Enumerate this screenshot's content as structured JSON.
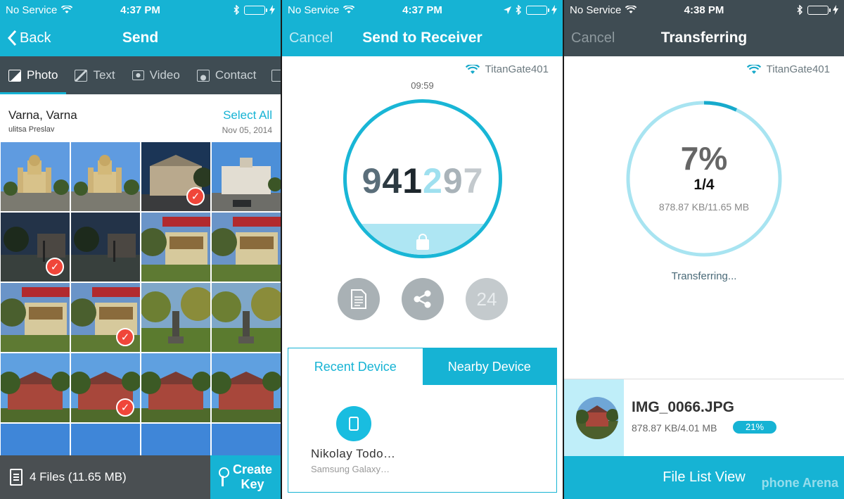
{
  "colors": {
    "accent": "#16b3d4",
    "dark_tab": "#3f4c53",
    "check": "#f0463a"
  },
  "screen1": {
    "status": {
      "carrier": "No Service",
      "time": "4:37 PM"
    },
    "nav": {
      "back_label": "Back",
      "title": "Send"
    },
    "tabs": [
      {
        "label": "Photo",
        "icon": "photo-icon"
      },
      {
        "label": "Text",
        "icon": "edit-icon"
      },
      {
        "label": "Video",
        "icon": "video-icon"
      },
      {
        "label": "Contact",
        "icon": "contact-icon"
      }
    ],
    "location": {
      "city": "Varna, Varna",
      "street": "ulitsa Preslav",
      "select_all": "Select All",
      "date": "Nov 05, 2014"
    },
    "photos": [
      {
        "scene": "cathedral",
        "selected": false
      },
      {
        "scene": "cathedral",
        "selected": false
      },
      {
        "scene": "building-dusk",
        "selected": true
      },
      {
        "scene": "building-day",
        "selected": false
      },
      {
        "scene": "dark-street",
        "selected": true
      },
      {
        "scene": "dark-street",
        "selected": false
      },
      {
        "scene": "garden-wall",
        "selected": false
      },
      {
        "scene": "garden-wall",
        "selected": false
      },
      {
        "scene": "garden-wall",
        "selected": false
      },
      {
        "scene": "garden-wall",
        "selected": true
      },
      {
        "scene": "park-statue",
        "selected": false
      },
      {
        "scene": "park-statue",
        "selected": false
      },
      {
        "scene": "red-building",
        "selected": false
      },
      {
        "scene": "red-building",
        "selected": true
      },
      {
        "scene": "red-building",
        "selected": false
      },
      {
        "scene": "red-building",
        "selected": false
      },
      {
        "scene": "trees-sky",
        "selected": false
      },
      {
        "scene": "trees-sky",
        "selected": false
      },
      {
        "scene": "trees-sky",
        "selected": false
      },
      {
        "scene": "trees-sky",
        "selected": false
      }
    ],
    "bottom": {
      "files_label": "4 Files (11.65 MB)",
      "create_key_line1": "Create",
      "create_key_line2": "Key"
    }
  },
  "screen2": {
    "status": {
      "carrier": "No Service",
      "time": "4:37 PM"
    },
    "nav": {
      "cancel_label": "Cancel",
      "title": "Send to Receiver"
    },
    "network": "TitanGate401",
    "timer": "09:59",
    "key_digits": [
      "9",
      "4",
      "1",
      "2",
      "9",
      "7"
    ],
    "key_digit_colors": [
      "#5a6e7a",
      "#2d3a42",
      "#1d262c",
      "#9fe0ef",
      "#a9b3b9",
      "#c3c9cd"
    ],
    "actions": [
      {
        "icon": "document-icon",
        "label": ""
      },
      {
        "icon": "share-icon",
        "label": ""
      },
      {
        "icon": "counter-badge",
        "label": "24"
      }
    ],
    "device_tabs": {
      "recent": "Recent Device",
      "nearby": "Nearby Device"
    },
    "device": {
      "name": "Nikolay Todo…",
      "model": "Samsung Galaxy…"
    }
  },
  "screen3": {
    "status": {
      "carrier": "No Service",
      "time": "4:38 PM"
    },
    "nav": {
      "cancel_label": "Cancel",
      "title": "Transferring"
    },
    "network": "TitanGate401",
    "progress_percent": 7,
    "percent_label": "7%",
    "count_label": "1/4",
    "size_label": "878.87 KB/11.65 MB",
    "status_label": "Transferring...",
    "file": {
      "name": "IMG_0066.JPG",
      "size": "878.87 KB/4.01 MB",
      "percent_label": "21%"
    },
    "file_list_label": "File List View",
    "watermark": "phone Arena"
  }
}
